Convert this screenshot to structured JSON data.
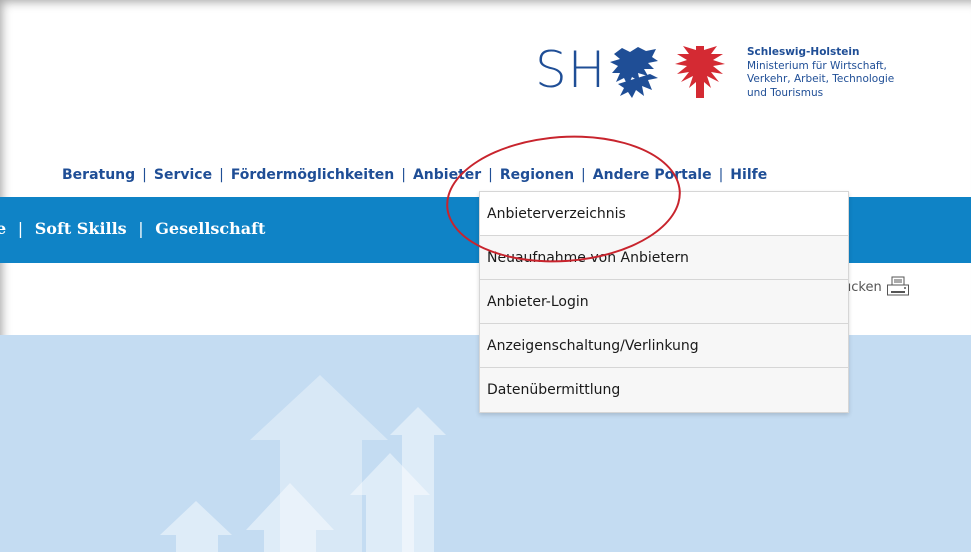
{
  "logo": {
    "sh_text": "SH",
    "org_name": "Schleswig-Holstein",
    "ministry_lines": [
      "Ministerium für Wirtschaft,",
      "Verkehr, Arbeit, Technologie",
      "und Tourismus"
    ]
  },
  "topnav": {
    "items": [
      "Beratung",
      "Service",
      "Fördermöglichkeiten",
      "Anbieter",
      "Regionen",
      "Andere Portale",
      "Hilfe"
    ],
    "separator": "|"
  },
  "category_bar": {
    "leading": "e",
    "items": [
      "Soft Skills",
      "Gesellschaft"
    ],
    "separator": "|"
  },
  "print": {
    "label": "ucken",
    "icon": "printer-icon"
  },
  "dropdown": {
    "items": [
      "Anbieterverzeichnis",
      "Neuaufnahme von Anbietern",
      "Anbieter-Login",
      "Anzeigenschaltung/Verlinkung",
      "Datenübermittlung"
    ]
  },
  "colors": {
    "brand_blue": "#1f4e96",
    "band_blue": "#0f83c6",
    "hero_blue": "#c4dcf2",
    "annotation_red": "#c8242d"
  }
}
